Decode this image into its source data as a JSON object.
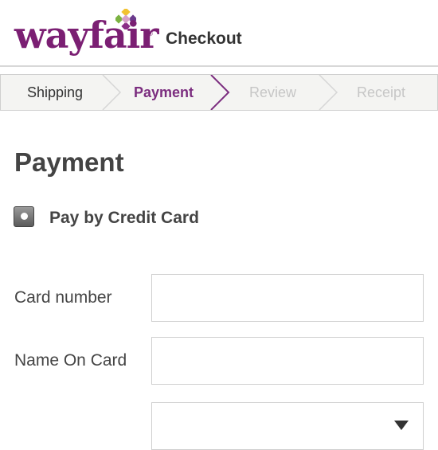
{
  "header": {
    "logo_text": "wayfair",
    "logo_mark": "registered",
    "title": "Checkout"
  },
  "steps": [
    {
      "label": "Shipping",
      "state": "done"
    },
    {
      "label": "Payment",
      "state": "active"
    },
    {
      "label": "Review",
      "state": "future"
    },
    {
      "label": "Receipt",
      "state": "future"
    }
  ],
  "colors": {
    "brand": "#7b1f73",
    "active_step": "#7b2d7f"
  },
  "payment": {
    "title": "Payment",
    "method_label": "Pay by Credit Card",
    "method_selected": true,
    "fields": {
      "card_number_label": "Card number",
      "card_number_value": "",
      "name_label": "Name On Card",
      "name_value": "",
      "select_value": ""
    }
  }
}
